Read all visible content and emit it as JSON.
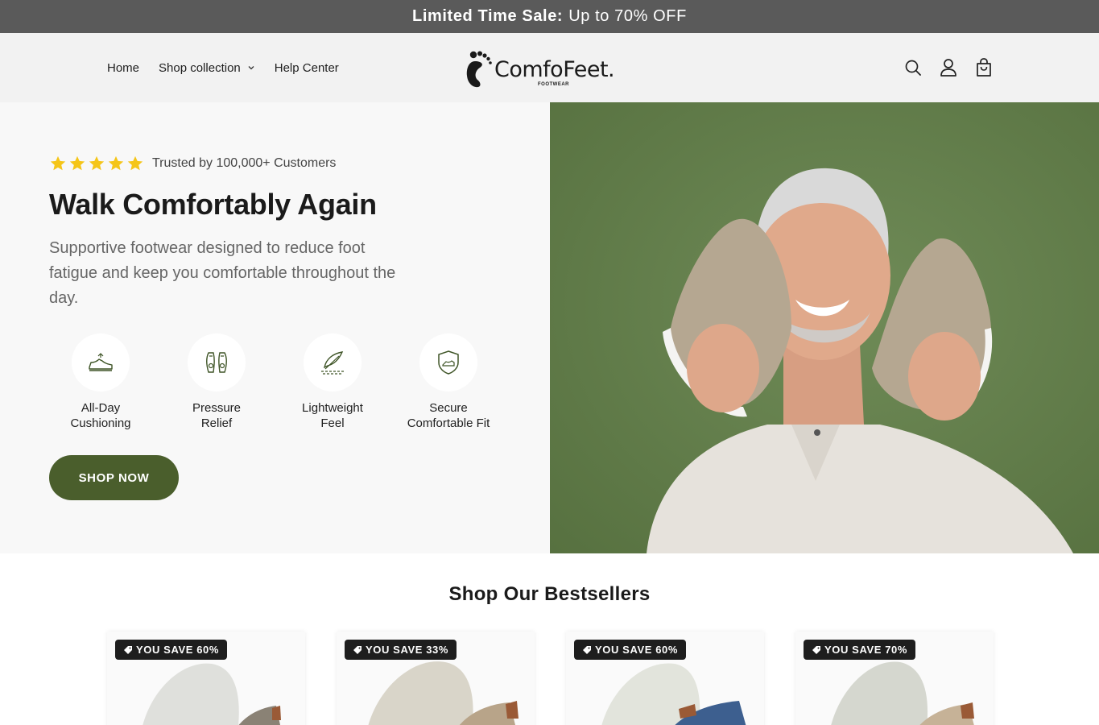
{
  "announcement": {
    "bold": "Limited Time Sale:",
    "text": "Up to 70% OFF"
  },
  "nav": {
    "home": "Home",
    "shop": "Shop collection",
    "help": "Help Center"
  },
  "logo": {
    "name": "ComfoFeet.",
    "sub": "FOOTWEAR"
  },
  "header_icons": [
    "search-icon",
    "account-icon",
    "cart-icon"
  ],
  "hero": {
    "rating": 5,
    "trusted": "Trusted by 100,000+ Customers",
    "title": "Walk Comfortably Again",
    "subtitle": "Supportive footwear designed to reduce foot fatigue and keep you comfortable throughout the day.",
    "features": [
      {
        "line1": "All-Day",
        "line2": "Cushioning",
        "icon": "sneaker-icon"
      },
      {
        "line1": "Pressure",
        "line2": "Relief",
        "icon": "insole-icon"
      },
      {
        "line1": "Lightweight",
        "line2": "Feel",
        "icon": "feather-icon"
      },
      {
        "line1": "Secure",
        "line2": "Comfortable Fit",
        "icon": "shield-icon"
      }
    ],
    "cta": "SHOP NOW"
  },
  "bestsellers": {
    "title": "Shop Our Bestsellers",
    "cards": [
      {
        "badge": "YOU SAVE 60%",
        "color": "#8a8275"
      },
      {
        "badge": "YOU SAVE 33%",
        "color": "#b8a489"
      },
      {
        "badge": "YOU SAVE 60%",
        "color": "#3d5f8f"
      },
      {
        "badge": "YOU SAVE 70%",
        "color": "#c6b297"
      }
    ]
  },
  "colors": {
    "accent": "#4a5e2c",
    "announce_bg": "#5a5a5a",
    "star": "#f5c518",
    "hero_bg": "#66824f"
  }
}
